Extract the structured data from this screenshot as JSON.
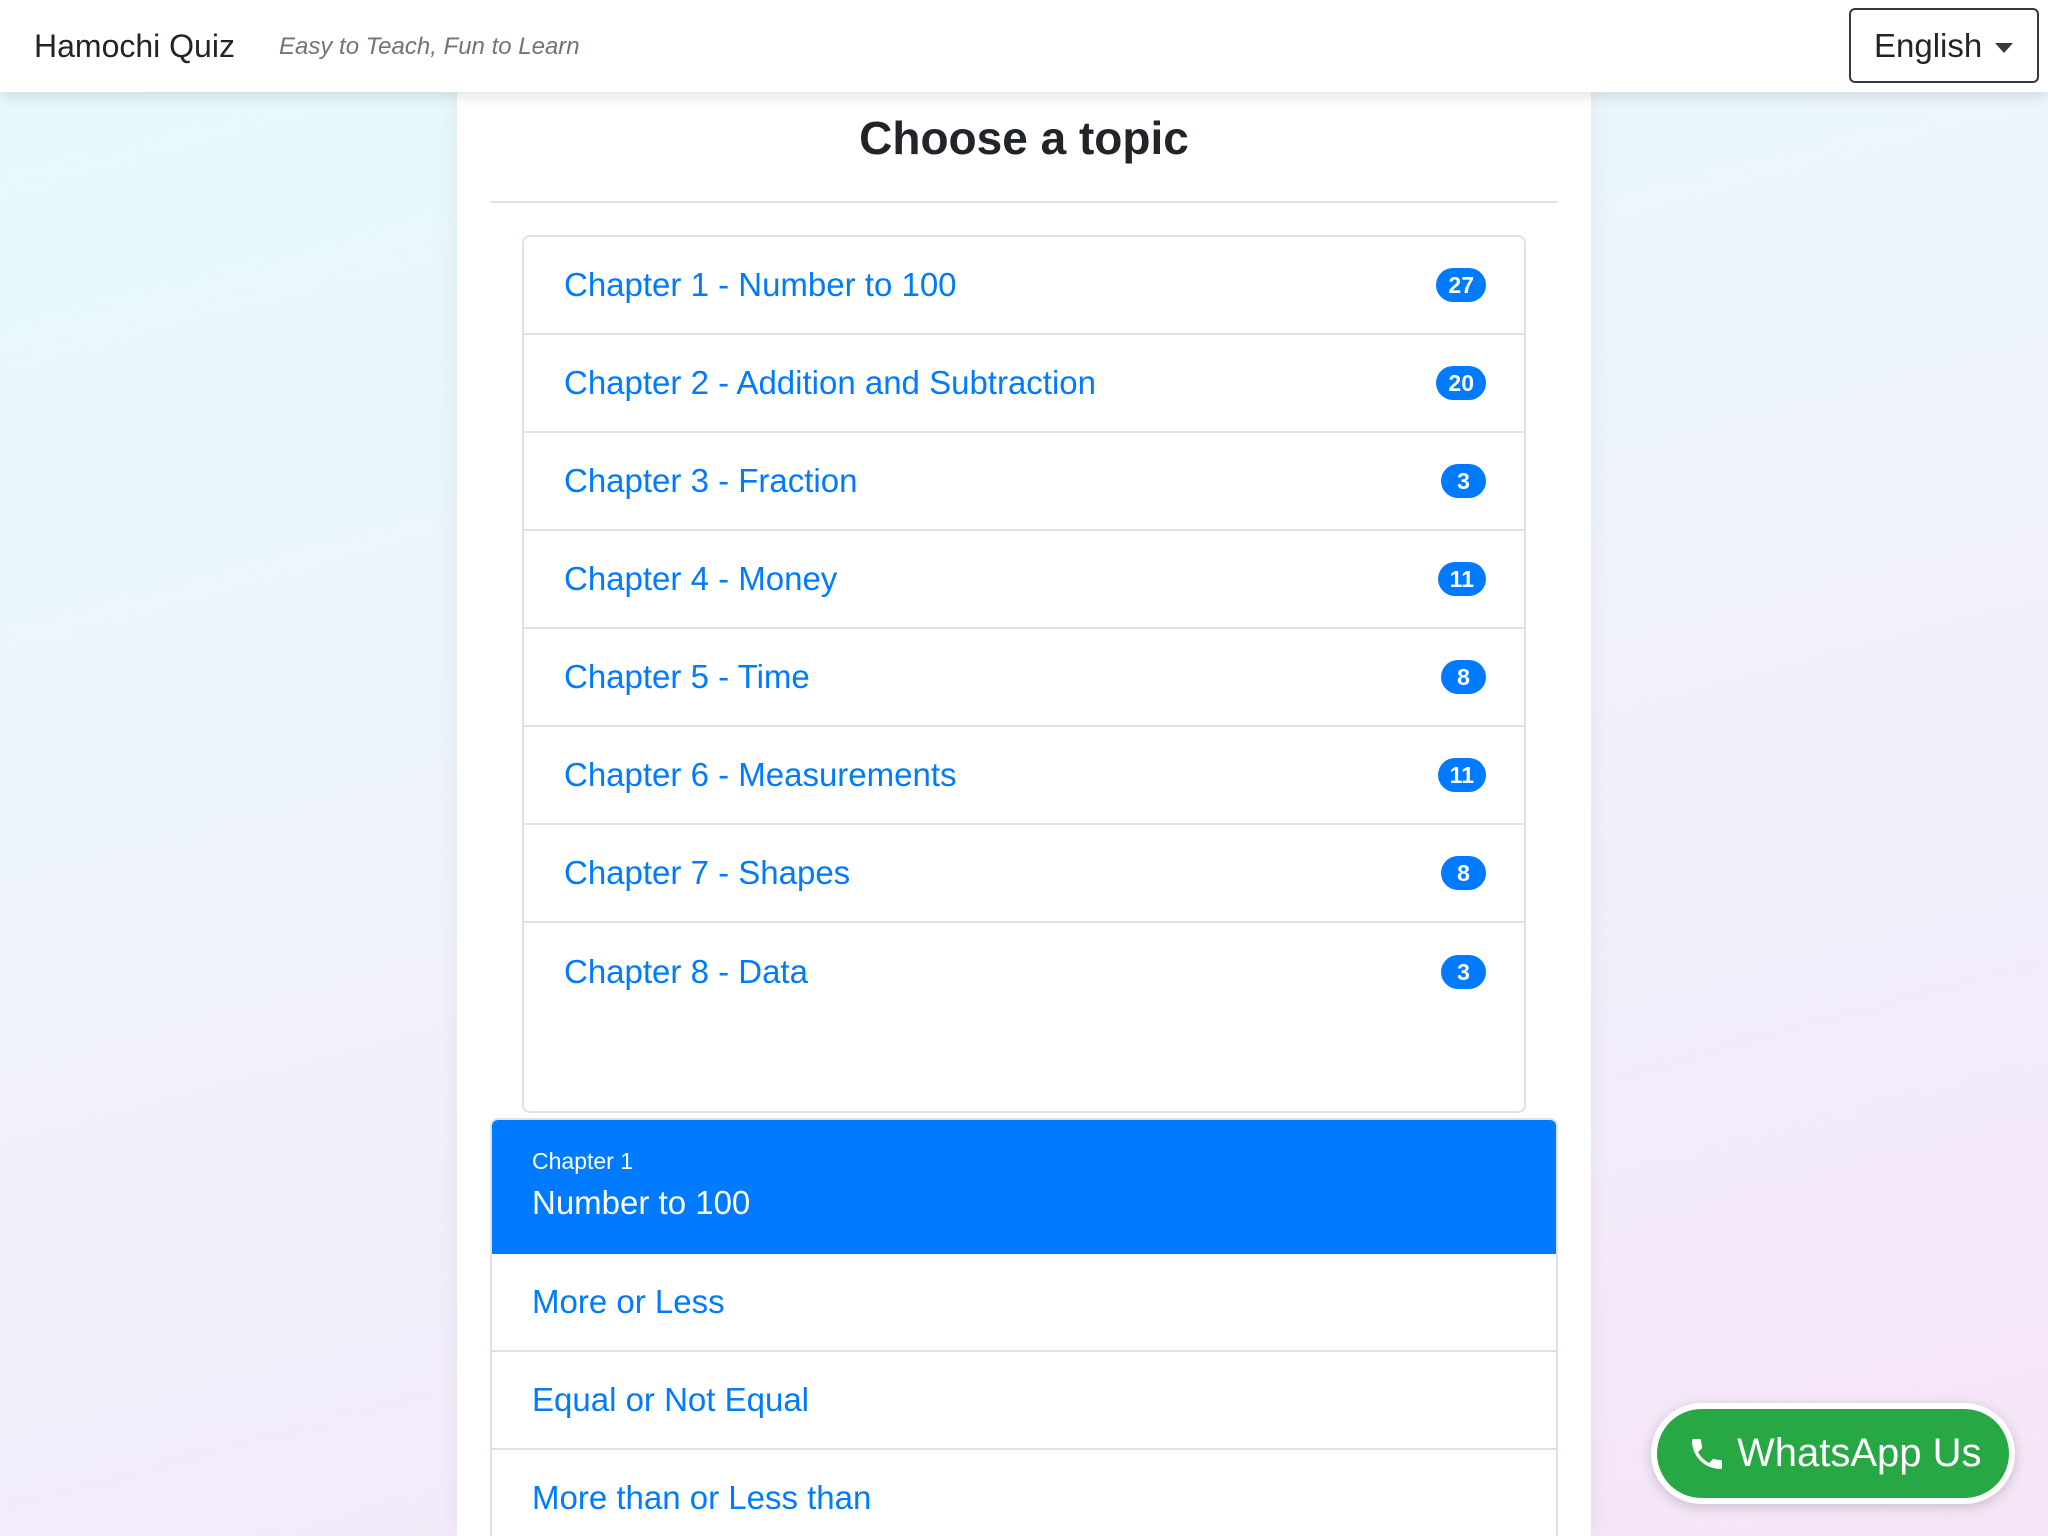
{
  "navbar": {
    "brand": "Hamochi Quiz",
    "tagline": "Easy to Teach, Fun to Learn",
    "language": "English"
  },
  "page_title": "Choose a topic",
  "topics": [
    {
      "label": "Chapter 1 - Number to 100",
      "count": "27"
    },
    {
      "label": "Chapter 2 - Addition and Subtraction",
      "count": "20"
    },
    {
      "label": "Chapter 3 - Fraction",
      "count": "3"
    },
    {
      "label": "Chapter 4 - Money",
      "count": "11"
    },
    {
      "label": "Chapter 5 - Time",
      "count": "8"
    },
    {
      "label": "Chapter 6 - Measurements",
      "count": "11"
    },
    {
      "label": "Chapter 7 - Shapes",
      "count": "8"
    },
    {
      "label": "Chapter 8 - Data",
      "count": "3"
    }
  ],
  "chapter_section": {
    "eyebrow": "Chapter 1",
    "title": "Number to 100",
    "items": [
      "More or Less",
      "Equal or Not Equal",
      "More than or Less than"
    ]
  },
  "whatsapp": {
    "label": "WhatsApp Us",
    "icon": "phone-icon"
  },
  "colors": {
    "primary": "#007bff",
    "whatsapp_green": "#28a745",
    "text_dark": "#212529",
    "text_muted": "#6c757d"
  }
}
